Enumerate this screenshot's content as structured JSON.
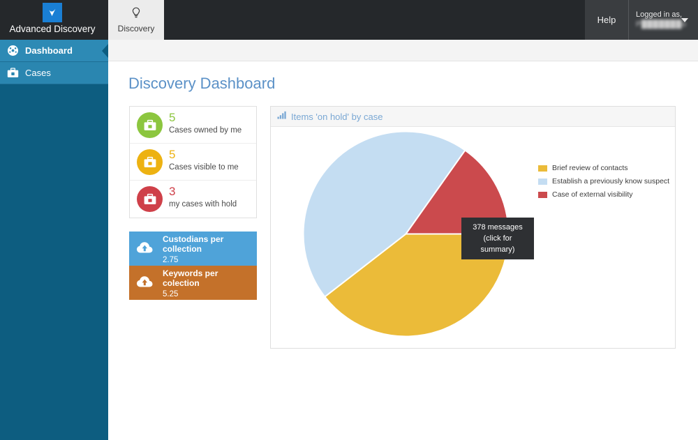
{
  "app": {
    "brand_name": "Advanced Discovery",
    "logo_icon": "blue-checkmark-logo"
  },
  "topbar": {
    "tab": {
      "label": "Discovery",
      "icon": "lightbulb-icon"
    },
    "help_label": "Help",
    "user": {
      "label": "Logged in as,",
      "name": "P███████o",
      "caret_icon": "chevron-down-icon"
    }
  },
  "sidebar": {
    "items": [
      {
        "label": "Dashboard",
        "icon": "dashboard-gauge-icon",
        "active": true
      },
      {
        "label": "Cases",
        "icon": "briefcase-icon",
        "active": false
      }
    ]
  },
  "main": {
    "page_title": "Discovery Dashboard"
  },
  "stats": [
    {
      "value": "5",
      "caption": "Cases owned by me",
      "color": "#8cc63f",
      "icon": "briefcase-icon"
    },
    {
      "value": "5",
      "caption": "Cases visible to me",
      "color": "#edb212",
      "icon": "briefcase-icon"
    },
    {
      "value": "3",
      "caption": "my cases with hold",
      "color": "#cf4049",
      "icon": "briefcase-icon"
    }
  ],
  "tiles": [
    {
      "title": "Custodians per collection",
      "value": "2.75",
      "bg": "#4fa3d9",
      "icon": "cloud-upload-icon"
    },
    {
      "title": "Keywords per colection",
      "value": "5.25",
      "bg": "#c4712a",
      "icon": "cloud-upload-icon"
    }
  ],
  "chart_panel": {
    "title": "Items 'on hold' by case",
    "title_icon": "bar-chart-icon",
    "tooltip": {
      "line1": "378 messages",
      "line2": "(click for summary)"
    }
  },
  "chart_data": {
    "type": "pie",
    "title": "Items 'on hold' by case",
    "categories": [
      "Brief review of contacts",
      "Establish a previously know suspect",
      "Case of external visibility"
    ],
    "values": [
      39.5,
      45.3,
      15.2
    ],
    "unit": "percent",
    "colors": [
      "#ebbb39",
      "#c4ddf2",
      "#cb4a4d"
    ],
    "legend_position": "right",
    "start_angle_deg": 0,
    "direction": "clockwise",
    "slice_angles_deg": [
      142.2,
      163.1,
      54.7
    ],
    "annotations": [
      "378 messages",
      "(click for summary)"
    ],
    "xlabel": "",
    "ylabel": ""
  }
}
